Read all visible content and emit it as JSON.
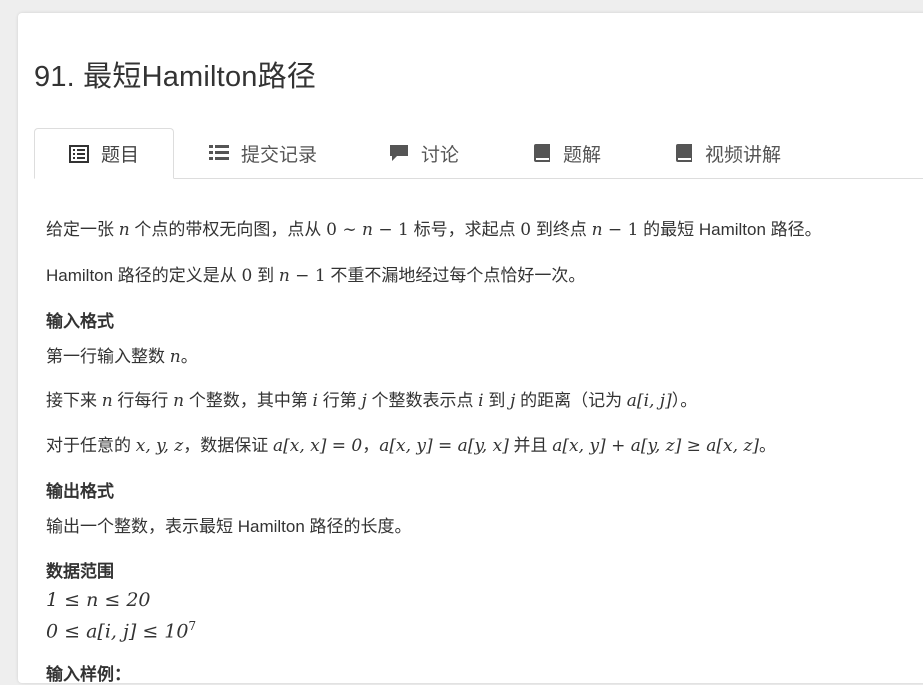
{
  "problem": {
    "title": "91. 最短Hamilton路径"
  },
  "tabs": [
    {
      "label": "题目",
      "icon": "document-list-icon"
    },
    {
      "label": "提交记录",
      "icon": "list-icon"
    },
    {
      "label": "讨论",
      "icon": "comment-icon"
    },
    {
      "label": "题解",
      "icon": "book-icon"
    },
    {
      "label": "视频讲解",
      "icon": "book-icon"
    }
  ],
  "statement": {
    "line1": {
      "a": "给定一张 ",
      "b": "n",
      "c": " 个点的带权无向图，点从 ",
      "d": "0 ∼ ",
      "e": "n",
      "f": " − 1",
      "g": " 标号，求起点 ",
      "h": "0",
      "i": " 到终点 ",
      "j": "n",
      "k": " − 1",
      "l": " 的最短 Hamilton 路径。"
    },
    "line2": {
      "a": "Hamilton 路径的定义是从 ",
      "b": "0",
      "c": " 到 ",
      "d": "n",
      "e": " − 1",
      "f": " 不重不漏地经过每个点恰好一次。"
    },
    "input_heading": "输入格式",
    "input1": {
      "a": "第一行输入整数 ",
      "b": "n",
      "c": "。"
    },
    "input2": {
      "a": "接下来 ",
      "b": "n",
      "c": " 行每行 ",
      "d": "n",
      "e": " 个整数，其中第 ",
      "f": "i",
      "g": " 行第 ",
      "h": "j",
      "i": " 个整数表示点 ",
      "j": "i",
      "k": " 到 ",
      "l": "j",
      "m": " 的距离（记为 ",
      "n": "a[i, j]",
      "o": "）。"
    },
    "input3": {
      "a": "对于任意的 ",
      "b": "x, y, z",
      "c": "，数据保证 ",
      "d": "a[x, x] = 0",
      "e": "，",
      "f": "a[x, y] = a[y, x]",
      "g": " 并且 ",
      "h": "a[x, y] + a[y, z] ≥ a[x, z]",
      "i": "。"
    },
    "output_heading": "输出格式",
    "output1": "输出一个整数，表示最短 Hamilton 路径的长度。",
    "range_heading": "数据范围",
    "range1": "1 ≤ n ≤ 20",
    "range2_a": "0 ≤ a[i, j] ≤ 10",
    "range2_sup": "7",
    "sample_heading": "输入样例："
  }
}
